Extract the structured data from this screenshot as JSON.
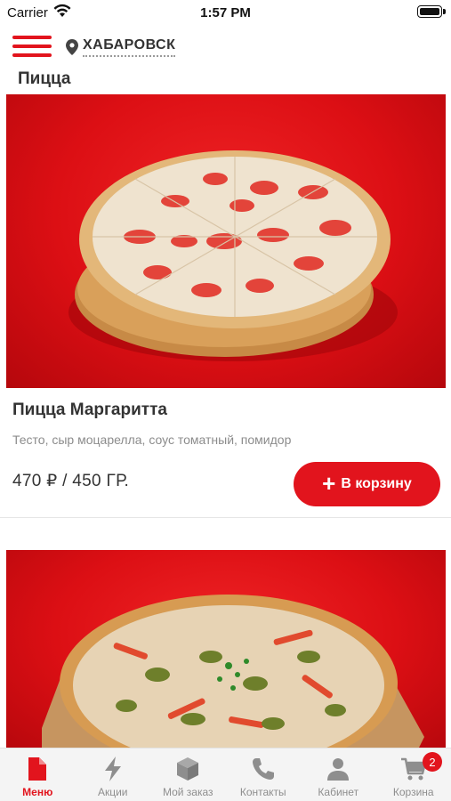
{
  "status_bar": {
    "carrier": "Carrier",
    "time": "1:57 PM"
  },
  "header": {
    "menu_icon": "hamburger-icon",
    "pin_icon": "location-pin-icon",
    "city": "ХАБАРОВСК"
  },
  "section_title": "Пицца",
  "products": [
    {
      "name": "Пицца Маргаритта",
      "description": "Тесто, сыр моцарелла, соус томатный, помидор",
      "price": "470 ₽ / 450 ГР.",
      "add_label": "В корзину",
      "image": "margherita-pizza-photo"
    },
    {
      "image": "vegetable-pizza-photo"
    }
  ],
  "tabs": [
    {
      "label": "Меню",
      "icon": "menu-document-icon",
      "active": true
    },
    {
      "label": "Акции",
      "icon": "lightning-icon",
      "active": false
    },
    {
      "label": "Мой заказ",
      "icon": "box-icon",
      "active": false
    },
    {
      "label": "Контакты",
      "icon": "phone-icon",
      "active": false
    },
    {
      "label": "Кабинет",
      "icon": "user-icon",
      "active": false
    },
    {
      "label": "Корзина",
      "icon": "cart-icon",
      "active": false,
      "badge": "2"
    }
  ],
  "colors": {
    "accent": "#e2141d",
    "inactive_tab": "#8e8e8e"
  }
}
